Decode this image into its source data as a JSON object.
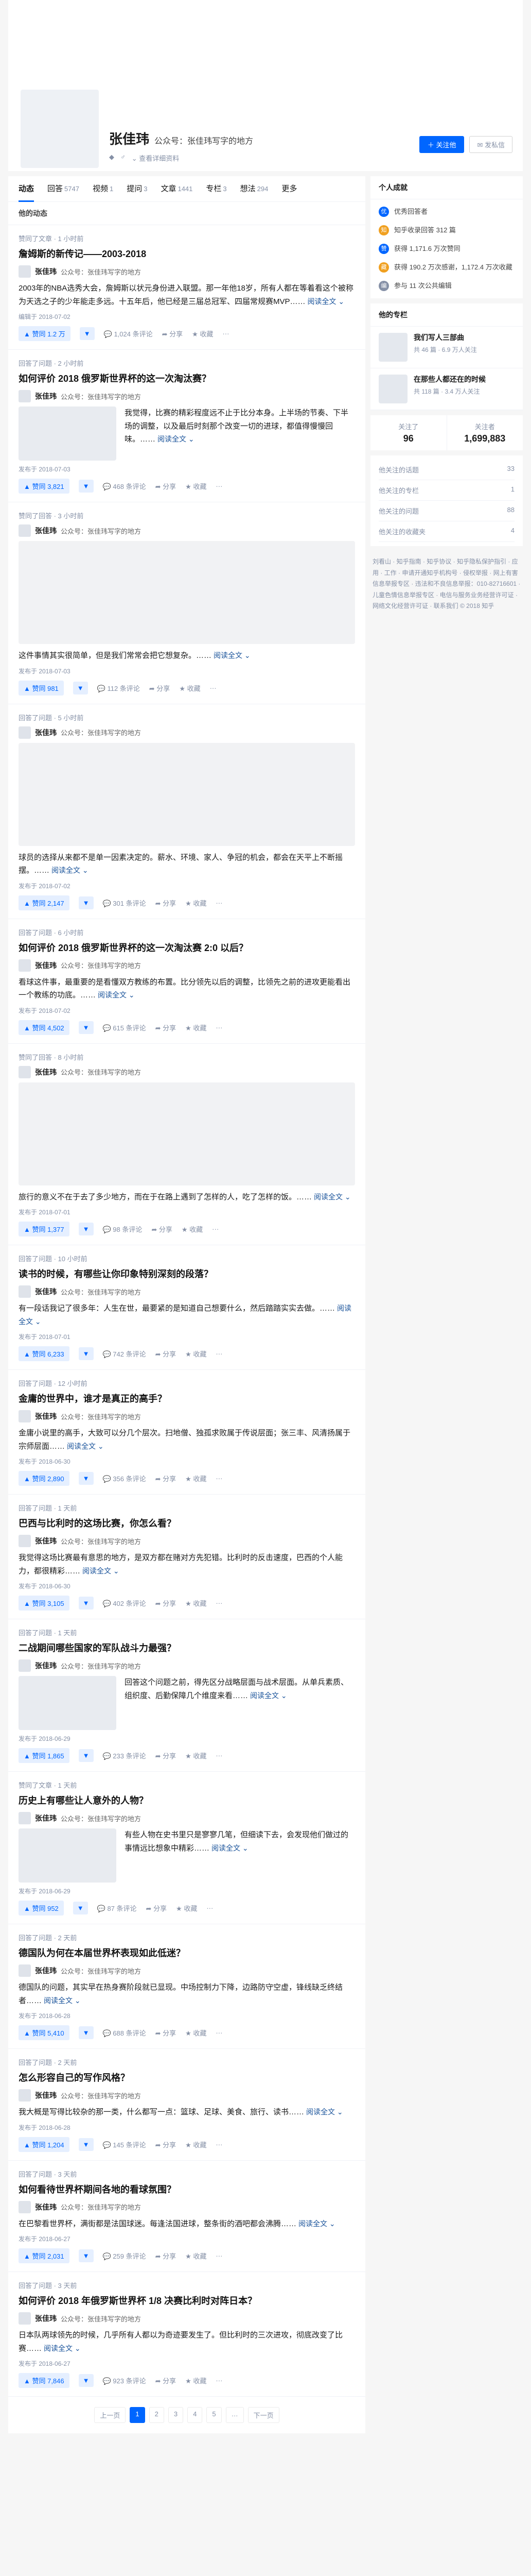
{
  "profile": {
    "name": "张佳玮",
    "headline": "公众号：张佳玮写字的地方",
    "follow_label": "＋ 关注他",
    "message_label": "✉ 发私信",
    "detail_label": "⌄ 查看详细资料"
  },
  "tabs": [
    {
      "label": "动态",
      "count": ""
    },
    {
      "label": "回答",
      "count": "5747"
    },
    {
      "label": "视频",
      "count": "1"
    },
    {
      "label": "提问",
      "count": "3"
    },
    {
      "label": "文章",
      "count": "1441"
    },
    {
      "label": "专栏",
      "count": "3"
    },
    {
      "label": "想法",
      "count": "294"
    },
    {
      "label": "更多",
      "count": ""
    }
  ],
  "list_head": "他的动态",
  "feed": [
    {
      "meta": "赞同了文章 · 1 小时前",
      "title": "詹姆斯的新传记——2003-2018",
      "author": "张佳玮",
      "desc": "公众号：张佳玮写字的地方",
      "content": "2003年的NBA选秀大会，詹姆斯以状元身份进入联盟。那一年他18岁，所有人都在等着看这个被称为天选之子的少年能走多远。十五年后，他已经是三届总冠军、四届常规赛MVP……",
      "date": "编辑于 2018-07-02",
      "votes": "▲ 赞同 1.2 万",
      "comments": "💬 1,024 条评论",
      "shares": "➦ 分享",
      "fav": "★ 收藏",
      "img": false,
      "big": false
    },
    {
      "meta": "回答了问题 · 2 小时前",
      "title": "如何评价 2018 俄罗斯世界杯的这一次淘汰赛？",
      "author": "张佳玮",
      "desc": "公众号：张佳玮写字的地方",
      "content": "我觉得，比赛的精彩程度远不止于比分本身。上半场的节奏、下半场的调整，以及最后时刻那个改变一切的进球，都值得慢慢回味。……",
      "date": "发布于 2018-07-03",
      "votes": "▲ 赞同 3,821",
      "comments": "💬 468 条评论",
      "shares": "➦ 分享",
      "fav": "★ 收藏",
      "img": true,
      "big": false
    },
    {
      "meta": "赞同了回答 · 3 小时前",
      "title": "",
      "author": "张佳玮",
      "desc": "公众号：张佳玮写字的地方",
      "content": "这件事情其实很简单，但是我们常常会把它想复杂。……",
      "date": "发布于 2018-07-03",
      "votes": "▲ 赞同 981",
      "comments": "💬 112 条评论",
      "shares": "➦ 分享",
      "fav": "★ 收藏",
      "img": false,
      "big": true
    },
    {
      "meta": "回答了问题 · 5 小时前",
      "title": "",
      "author": "张佳玮",
      "desc": "公众号：张佳玮写字的地方",
      "content": "球员的选择从来都不是单一因素决定的。薪水、环境、家人、争冠的机会，都会在天平上不断摇摆。……",
      "date": "发布于 2018-07-02",
      "votes": "▲ 赞同 2,147",
      "comments": "💬 301 条评论",
      "shares": "➦ 分享",
      "fav": "★ 收藏",
      "img": false,
      "big": true
    },
    {
      "meta": "回答了问题 · 6 小时前",
      "title": "如何评价 2018 俄罗斯世界杯的这一次淘汰赛 2:0 以后？",
      "author": "张佳玮",
      "desc": "公众号：张佳玮写字的地方",
      "content": "看球这件事，最重要的是看懂双方教练的布置。比分领先以后的调整，比领先之前的进攻更能看出一个教练的功底。……",
      "date": "发布于 2018-07-02",
      "votes": "▲ 赞同 4,502",
      "comments": "💬 615 条评论",
      "shares": "➦ 分享",
      "fav": "★ 收藏",
      "img": false,
      "big": false
    },
    {
      "meta": "赞同了回答 · 8 小时前",
      "title": "",
      "author": "张佳玮",
      "desc": "公众号：张佳玮写字的地方",
      "content": "旅行的意义不在于去了多少地方，而在于在路上遇到了怎样的人，吃了怎样的饭。……",
      "date": "发布于 2018-07-01",
      "votes": "▲ 赞同 1,377",
      "comments": "💬 98 条评论",
      "shares": "➦ 分享",
      "fav": "★ 收藏",
      "img": false,
      "big": true
    },
    {
      "meta": "回答了问题 · 10 小时前",
      "title": "读书的时候，有哪些让你印象特别深刻的段落？",
      "author": "张佳玮",
      "desc": "公众号：张佳玮写字的地方",
      "content": "有一段话我记了很多年：人生在世，最要紧的是知道自己想要什么，然后踏踏实实去做。……",
      "date": "发布于 2018-07-01",
      "votes": "▲ 赞同 6,233",
      "comments": "💬 742 条评论",
      "shares": "➦ 分享",
      "fav": "★ 收藏",
      "img": false,
      "big": false
    },
    {
      "meta": "回答了问题 · 12 小时前",
      "title": "金庸的世界中，谁才是真正的高手？",
      "author": "张佳玮",
      "desc": "公众号：张佳玮写字的地方",
      "content": "金庸小说里的高手，大致可以分几个层次。扫地僧、独孤求败属于传说层面；张三丰、风清扬属于宗师层面……",
      "date": "发布于 2018-06-30",
      "votes": "▲ 赞同 2,890",
      "comments": "💬 356 条评论",
      "shares": "➦ 分享",
      "fav": "★ 收藏",
      "img": false,
      "big": false
    },
    {
      "meta": "回答了问题 · 1 天前",
      "title": "巴西与比利时的这场比赛，你怎么看？",
      "author": "张佳玮",
      "desc": "公众号：张佳玮写字的地方",
      "content": "我觉得这场比赛最有意思的地方，是双方都在赌对方先犯错。比利时的反击速度，巴西的个人能力，都很精彩……",
      "date": "发布于 2018-06-30",
      "votes": "▲ 赞同 3,105",
      "comments": "💬 402 条评论",
      "shares": "➦ 分享",
      "fav": "★ 收藏",
      "img": false,
      "big": false
    },
    {
      "meta": "回答了问题 · 1 天前",
      "title": "二战期间哪些国家的军队战斗力最强？",
      "author": "张佳玮",
      "desc": "公众号：张佳玮写字的地方",
      "content": "回答这个问题之前，得先区分战略层面与战术层面。从单兵素质、组织度、后勤保障几个维度来看……",
      "date": "发布于 2018-06-29",
      "votes": "▲ 赞同 1,865",
      "comments": "💬 233 条评论",
      "shares": "➦ 分享",
      "fav": "★ 收藏",
      "img": true,
      "big": false
    },
    {
      "meta": "赞同了文章 · 1 天前",
      "title": "历史上有哪些让人意外的人物？",
      "author": "张佳玮",
      "desc": "公众号：张佳玮写字的地方",
      "content": "有些人物在史书里只是寥寥几笔，但细读下去，会发现他们做过的事情远比想象中精彩……",
      "date": "发布于 2018-06-29",
      "votes": "▲ 赞同 952",
      "comments": "💬 87 条评论",
      "shares": "➦ 分享",
      "fav": "★ 收藏",
      "img": true,
      "big": false
    },
    {
      "meta": "回答了问题 · 2 天前",
      "title": "德国队为何在本届世界杯表现如此低迷？",
      "author": "张佳玮",
      "desc": "公众号：张佳玮写字的地方",
      "content": "德国队的问题，其实早在热身赛阶段就已显现。中场控制力下降，边路防守空虚，锋线缺乏终结者……",
      "date": "发布于 2018-06-28",
      "votes": "▲ 赞同 5,410",
      "comments": "💬 688 条评论",
      "shares": "➦ 分享",
      "fav": "★ 收藏",
      "img": false,
      "big": false
    },
    {
      "meta": "回答了问题 · 2 天前",
      "title": "怎么形容自己的写作风格？",
      "author": "张佳玮",
      "desc": "公众号：张佳玮写字的地方",
      "content": "我大概是写得比较杂的那一类，什么都写一点：篮球、足球、美食、旅行、读书……",
      "date": "发布于 2018-06-28",
      "votes": "▲ 赞同 1,204",
      "comments": "💬 145 条评论",
      "shares": "➦ 分享",
      "fav": "★ 收藏",
      "img": false,
      "big": false
    },
    {
      "meta": "回答了问题 · 3 天前",
      "title": "如何看待世界杯期间各地的看球氛围？",
      "author": "张佳玮",
      "desc": "公众号：张佳玮写字的地方",
      "content": "在巴黎看世界杯，满街都是法国球迷。每逢法国进球，整条街的酒吧都会沸腾……",
      "date": "发布于 2018-06-27",
      "votes": "▲ 赞同 2,031",
      "comments": "💬 259 条评论",
      "shares": "➦ 分享",
      "fav": "★ 收藏",
      "img": false,
      "big": false
    },
    {
      "meta": "回答了问题 · 3 天前",
      "title": "如何评价 2018 年俄罗斯世界杯 1/8 决赛比利时对阵日本？",
      "author": "张佳玮",
      "desc": "公众号：张佳玮写字的地方",
      "content": "日本队两球领先的时候，几乎所有人都以为奇迹要发生了。但比利时的三次进攻，彻底改变了比赛……",
      "date": "发布于 2018-06-27",
      "votes": "▲ 赞同 7,846",
      "comments": "💬 923 条评论",
      "shares": "➦ 分享",
      "fav": "★ 收藏",
      "img": false,
      "big": false
    }
  ],
  "more_label": "阅读全文 ⌄",
  "pager": [
    "上一页",
    "1",
    "2",
    "3",
    "4",
    "5",
    "…",
    "下一页"
  ],
  "sidebar": {
    "achievements_title": "个人成就",
    "achievements": [
      {
        "icon": "优",
        "text": "优秀回答者"
      },
      {
        "icon": "知",
        "text": "知乎收录回答 312 篇"
      },
      {
        "icon": "赞",
        "text": "获得 1,171.6 万次赞同"
      },
      {
        "icon": "藏",
        "text": "获得 190.2 万次感谢，1,172.4 万次收藏"
      },
      {
        "icon": "编",
        "text": "参与 11 次公共编辑"
      }
    ],
    "columns_title": "他的专栏",
    "columns": [
      {
        "title": "我们写人三部曲",
        "sub": "共 46 篇 · 6.9 万人关注"
      },
      {
        "title": "在那些人都还在的时候",
        "sub": "共 118 篇 · 3.4 万人关注"
      }
    ],
    "following_label": "关注了",
    "following_count": "96",
    "followers_label": "关注者",
    "followers_count": "1,699,883",
    "links": [
      {
        "label": "他关注的话题",
        "value": "33"
      },
      {
        "label": "他关注的专栏",
        "value": "1"
      },
      {
        "label": "他关注的问题",
        "value": "88"
      },
      {
        "label": "他关注的收藏夹",
        "value": "4"
      }
    ],
    "footer": "刘看山 · 知乎指南 · 知乎协议 · 知乎隐私保护指引 · 应用 · 工作 · 申请开通知乎机构号 · 侵权举报 · 网上有害信息举报专区 · 违法和不良信息举报：010-82716601 · 儿童色情信息举报专区 · 电信与服务业务经营许可证 · 网络文化经营许可证 · 联系我们 © 2018 知乎"
  }
}
